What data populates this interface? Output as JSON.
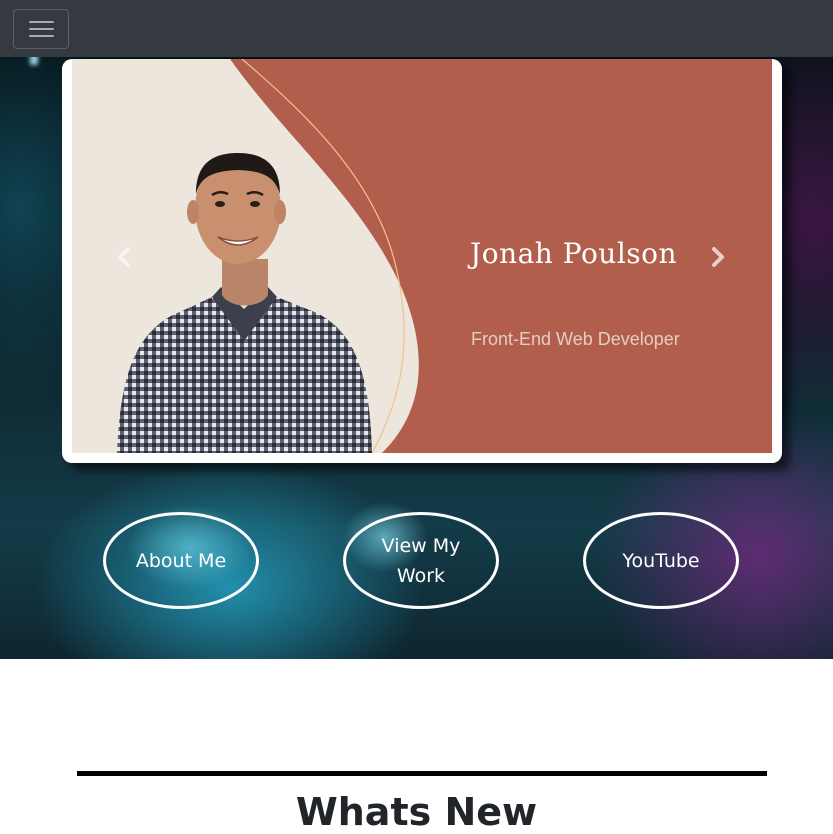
{
  "navbar": {
    "toggle_icon": "hamburger-menu-icon"
  },
  "carousel": {
    "slide": {
      "title": "Jonah Poulson",
      "subtitle": "Front-End Web Developer"
    },
    "prev_icon": "chevron-left-icon",
    "next_icon": "chevron-right-icon"
  },
  "hero_buttons": {
    "about_label": "About Me",
    "work_label_line1": "View My",
    "work_label_line2": "Work",
    "youtube_label": "YouTube"
  },
  "section": {
    "heading": "Whats New"
  },
  "colors": {
    "navbar": "#343a40",
    "slide_accent": "#b15f4c",
    "slide_cream": "#ece6dc",
    "divider": "#000000"
  }
}
